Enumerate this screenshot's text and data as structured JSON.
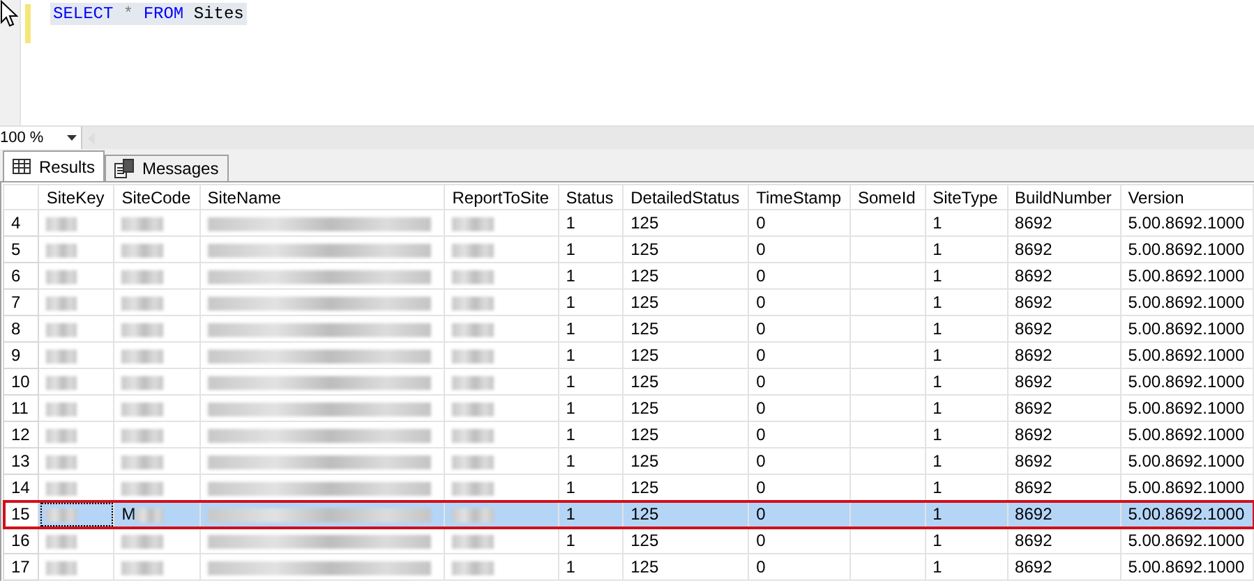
{
  "editor": {
    "query": [
      {
        "kind": "keyword",
        "text": "SELECT"
      },
      {
        "kind": "operator",
        "text": "*"
      },
      {
        "kind": "keyword",
        "text": "FROM"
      },
      {
        "kind": "identifier",
        "text": "Sites"
      }
    ],
    "modified": true
  },
  "zoom": {
    "value": "100 %"
  },
  "tabs": [
    {
      "label": "Results",
      "selected": true
    },
    {
      "label": "Messages",
      "selected": false
    }
  ],
  "grid": {
    "columns": [
      "SiteKey",
      "SiteCode",
      "SiteName",
      "ReportToSite",
      "Status",
      "DetailedStatus",
      "TimeStamp",
      "SomeId",
      "SiteType",
      "BuildNumber",
      "Version"
    ],
    "rows": [
      {
        "number": "4",
        "selected": false,
        "highlighted": false,
        "cells": [
          {
            "redacted": true
          },
          {
            "redacted": true
          },
          {
            "redacted": true
          },
          {
            "redacted": true
          },
          "1",
          "125",
          "0",
          null,
          "1",
          "8692",
          "5.00.8692.1000"
        ]
      },
      {
        "number": "5",
        "selected": false,
        "highlighted": false,
        "cells": [
          {
            "redacted": true
          },
          {
            "redacted": true
          },
          {
            "redacted": true
          },
          {
            "redacted": true
          },
          "1",
          "125",
          "0",
          null,
          "1",
          "8692",
          "5.00.8692.1000"
        ]
      },
      {
        "number": "6",
        "selected": false,
        "highlighted": false,
        "cells": [
          {
            "redacted": true
          },
          {
            "redacted": true
          },
          {
            "redacted": true
          },
          {
            "redacted": true
          },
          "1",
          "125",
          "0",
          null,
          "1",
          "8692",
          "5.00.8692.1000"
        ]
      },
      {
        "number": "7",
        "selected": false,
        "highlighted": false,
        "cells": [
          {
            "redacted": true
          },
          {
            "redacted": true
          },
          {
            "redacted": true
          },
          {
            "redacted": true
          },
          "1",
          "125",
          "0",
          null,
          "1",
          "8692",
          "5.00.8692.1000"
        ]
      },
      {
        "number": "8",
        "selected": false,
        "highlighted": false,
        "cells": [
          {
            "redacted": true
          },
          {
            "redacted": true
          },
          {
            "redacted": true
          },
          {
            "redacted": true
          },
          "1",
          "125",
          "0",
          null,
          "1",
          "8692",
          "5.00.8692.1000"
        ]
      },
      {
        "number": "9",
        "selected": false,
        "highlighted": false,
        "cells": [
          {
            "redacted": true
          },
          {
            "redacted": true
          },
          {
            "redacted": true
          },
          {
            "redacted": true
          },
          "1",
          "125",
          "0",
          null,
          "1",
          "8692",
          "5.00.8692.1000"
        ]
      },
      {
        "number": "10",
        "selected": false,
        "highlighted": false,
        "cells": [
          {
            "redacted": true
          },
          {
            "redacted": true
          },
          {
            "redacted": true
          },
          {
            "redacted": true
          },
          "1",
          "125",
          "0",
          null,
          "1",
          "8692",
          "5.00.8692.1000"
        ]
      },
      {
        "number": "11",
        "selected": false,
        "highlighted": false,
        "cells": [
          {
            "redacted": true
          },
          {
            "redacted": true
          },
          {
            "redacted": true
          },
          {
            "redacted": true
          },
          "1",
          "125",
          "0",
          null,
          "1",
          "8692",
          "5.00.8692.1000"
        ]
      },
      {
        "number": "12",
        "selected": false,
        "highlighted": false,
        "cells": [
          {
            "redacted": true
          },
          {
            "redacted": true
          },
          {
            "redacted": true
          },
          {
            "redacted": true
          },
          "1",
          "125",
          "0",
          null,
          "1",
          "8692",
          "5.00.8692.1000"
        ]
      },
      {
        "number": "13",
        "selected": false,
        "highlighted": false,
        "cells": [
          {
            "redacted": true
          },
          {
            "redacted": true
          },
          {
            "redacted": true
          },
          {
            "redacted": true
          },
          "1",
          "125",
          "0",
          null,
          "1",
          "8692",
          "5.00.8692.1000"
        ]
      },
      {
        "number": "14",
        "selected": false,
        "highlighted": false,
        "cells": [
          {
            "redacted": true
          },
          {
            "redacted": true
          },
          {
            "redacted": true
          },
          {
            "redacted": true
          },
          "1",
          "125",
          "0",
          null,
          "1",
          "8692",
          "5.00.8692.1000"
        ]
      },
      {
        "number": "15",
        "selected": true,
        "highlighted": true,
        "cells": [
          {
            "redacted": true
          },
          {
            "text": "M",
            "redacted": true
          },
          {
            "redacted": true
          },
          {
            "redacted": true
          },
          "1",
          "125",
          "0",
          null,
          "1",
          "8692",
          "5.00.8692.1000"
        ]
      },
      {
        "number": "16",
        "selected": false,
        "highlighted": false,
        "cells": [
          {
            "redacted": true
          },
          {
            "redacted": true
          },
          {
            "redacted": true
          },
          {
            "redacted": true
          },
          "1",
          "125",
          "0",
          null,
          "1",
          "8692",
          "5.00.8692.1000"
        ]
      },
      {
        "number": "17",
        "selected": false,
        "highlighted": false,
        "cells": [
          {
            "redacted": true
          },
          {
            "redacted": true
          },
          {
            "redacted": true
          },
          {
            "redacted": true
          },
          "1",
          "125",
          "0",
          null,
          "1",
          "8692",
          "5.00.8692.1000"
        ]
      }
    ]
  }
}
